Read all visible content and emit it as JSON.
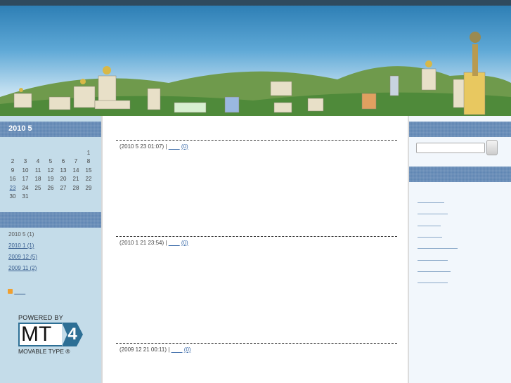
{
  "calendar": {
    "title": "2010  5",
    "weeks": [
      [
        "",
        "",
        "",
        "",
        "",
        "",
        "1"
      ],
      [
        "2",
        "3",
        "4",
        "5",
        "6",
        "7",
        "8"
      ],
      [
        "9",
        "10",
        "11",
        "12",
        "13",
        "14",
        "15"
      ],
      [
        "16",
        "17",
        "18",
        "19",
        "20",
        "21",
        "22"
      ],
      [
        "23",
        "24",
        "25",
        "26",
        "27",
        "28",
        "29"
      ],
      [
        "30",
        "31",
        "",
        "",
        "",
        "",
        ""
      ]
    ],
    "linked_day": "23"
  },
  "archives": [
    {
      "label": "2010 5  (1)",
      "link": false
    },
    {
      "label": "2010 1  (1)",
      "link": true
    },
    {
      "label": "2009 12  (5)",
      "link": true
    },
    {
      "label": "2009 11  (2)",
      "link": true
    }
  ],
  "feed_link": "　　",
  "powered": {
    "top": "POWERED BY",
    "logo": "MT",
    "version": "4",
    "bottom": "MOVABLE TYPE ®"
  },
  "posts": [
    {
      "meta": "(2010 5 23  01:07) | ",
      "link": "　　",
      "comments": "(0)"
    },
    {
      "meta": "(2010 1 21  23:54) | ",
      "link": "　　",
      "comments": "(0)"
    },
    {
      "meta": "(2009 12 21  00:11) | ",
      "link": "　　",
      "comments": "(0)"
    }
  ],
  "search": {
    "value": ""
  }
}
